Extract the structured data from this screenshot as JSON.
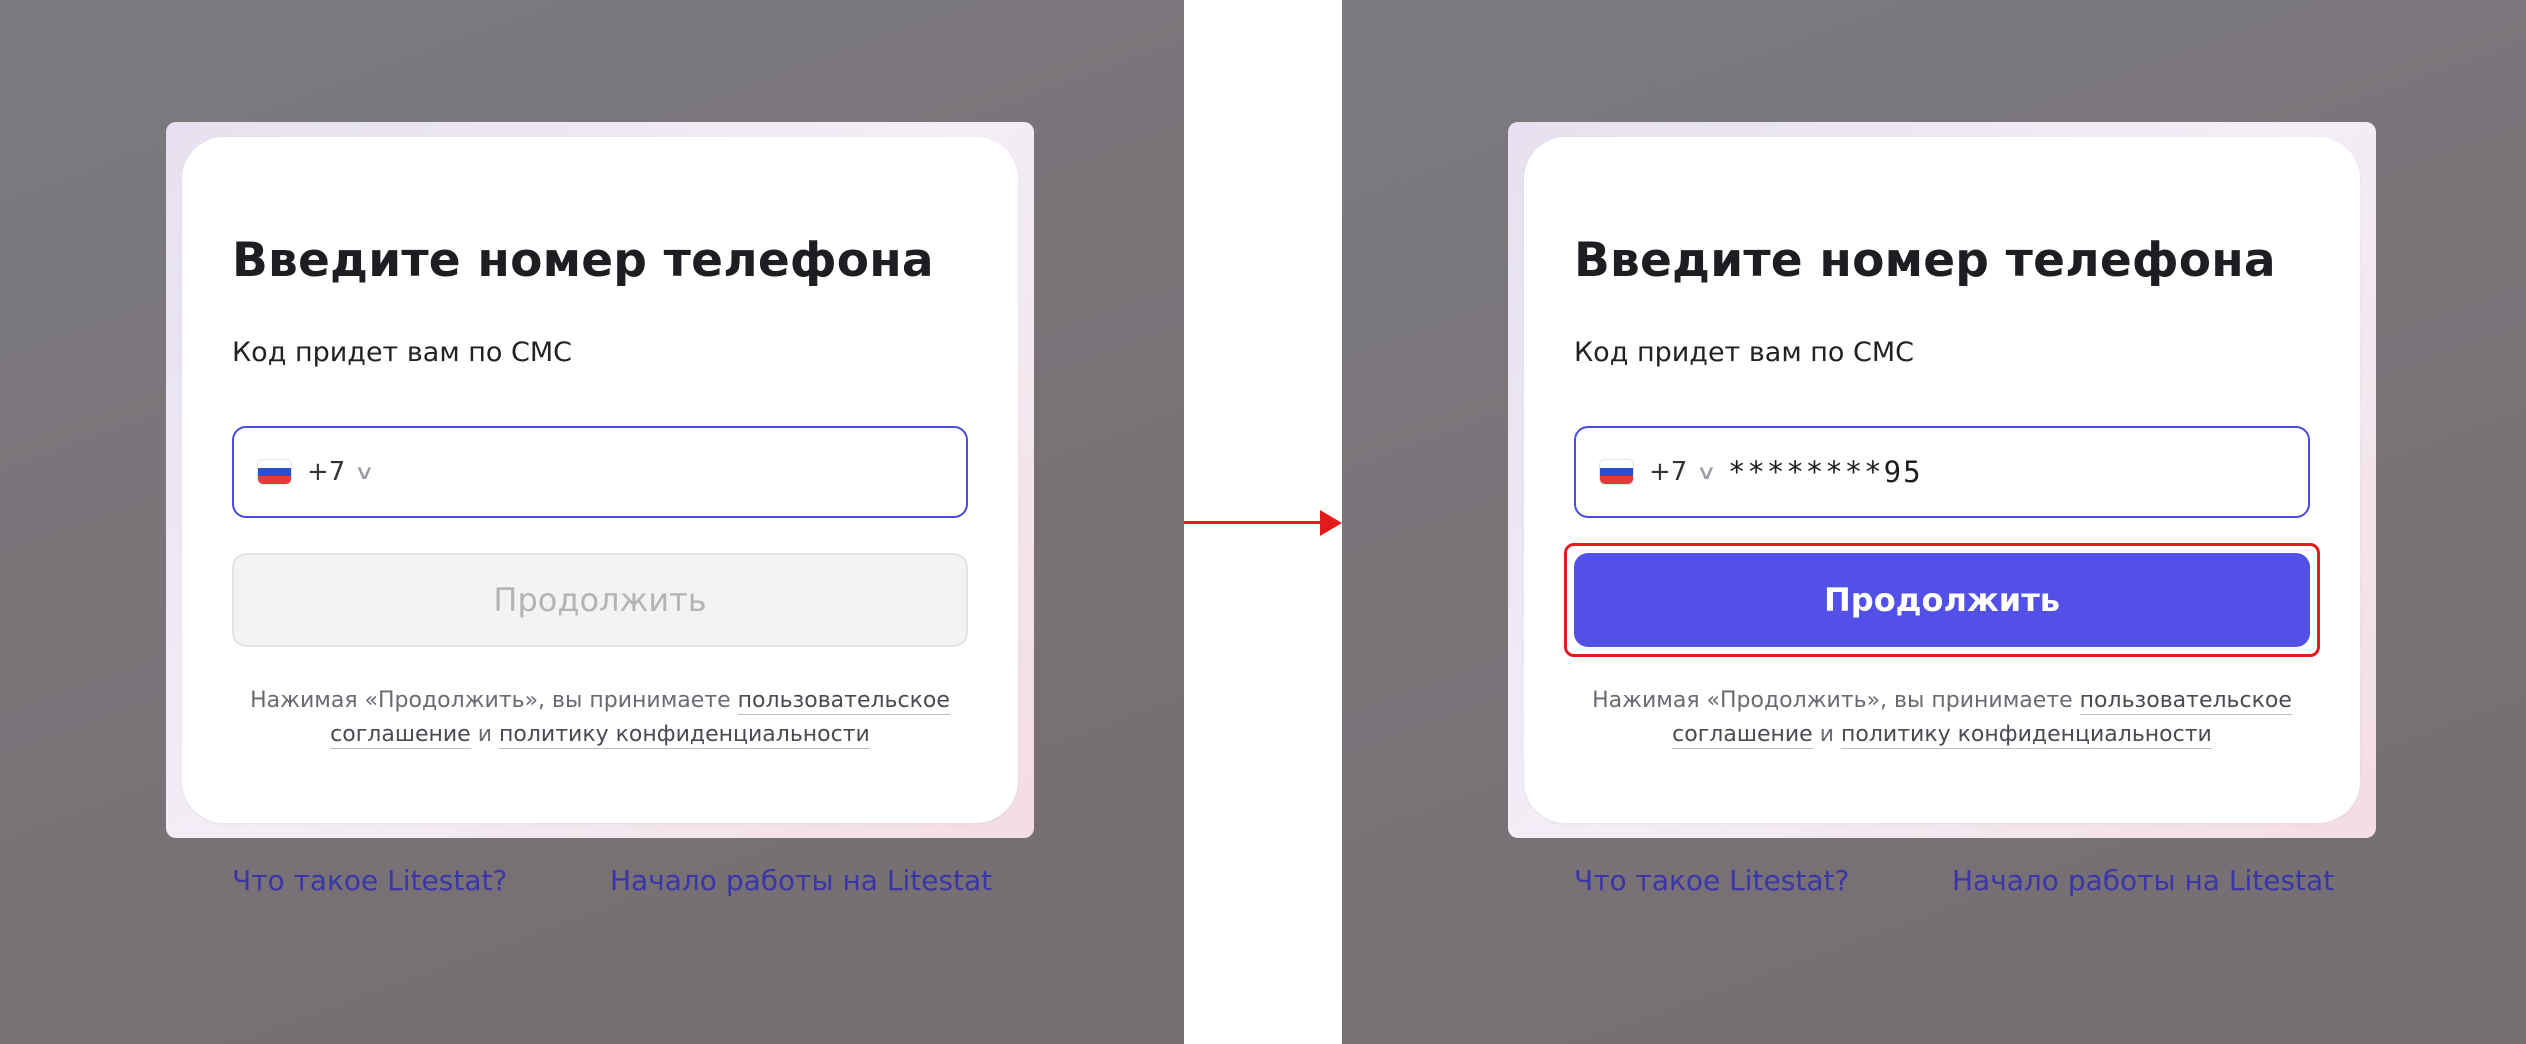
{
  "panels": {
    "before": {
      "title": "Введите номер телефона",
      "subtitle": "Код придет вам по СМС",
      "phone": {
        "country_code": "+7",
        "number": ""
      },
      "continue_button": "Продолжить",
      "continue_state": "disabled",
      "legal": {
        "prefix": "Нажимая «Продолжить», вы принимаете",
        "agreement_link": "пользовательское соглашение",
        "joiner": "и",
        "privacy_link": "политику конфиденциальности"
      },
      "footer_links": [
        "Что такое Litestat?",
        "Начало работы на Litestat"
      ]
    },
    "after": {
      "title": "Введите номер телефона",
      "subtitle": "Код придет вам по СМС",
      "phone": {
        "country_code": "+7",
        "number": "********95"
      },
      "continue_button": "Продолжить",
      "continue_state": "enabled",
      "legal": {
        "prefix": "Нажимая «Продолжить», вы принимаете",
        "agreement_link": "пользовательское соглашение",
        "joiner": "и",
        "privacy_link": "политику конфиденциальности"
      },
      "footer_links": [
        "Что такое Litestat?",
        "Начало работы на Litestat"
      ]
    }
  },
  "icons": {
    "flag": "russia-flag-icon",
    "chevron": "chevron-down-icon",
    "arrow": "arrow-right-icon"
  },
  "colors": {
    "accent": "#5250e6",
    "highlight": "#e31b1b",
    "link": "#3a36a8"
  }
}
